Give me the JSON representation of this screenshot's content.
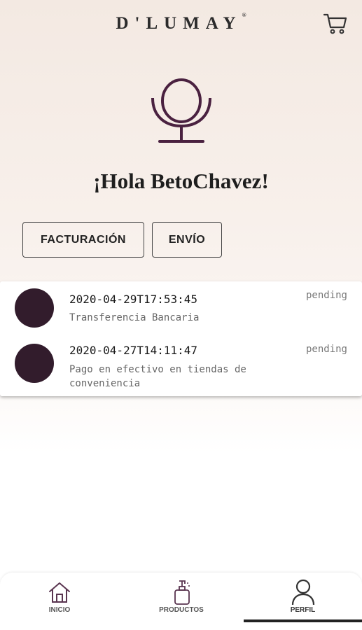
{
  "header": {
    "brand": "D'LUMAY",
    "registered_mark": "®",
    "cart_icon": "cart-icon"
  },
  "profile": {
    "icon": "mirror-icon",
    "greeting": "¡Hola BetoChavez!"
  },
  "actions": {
    "billing_label": "FACTURACIÓN",
    "shipping_label": "ENVÍO"
  },
  "orders": [
    {
      "date": "2020-04-29T17:53:45",
      "method": "Transferencia Bancaria",
      "status": "pending"
    },
    {
      "date": "2020-04-27T14:11:47",
      "method": "Pago en efectivo en tiendas de conveniencia",
      "status": "pending"
    }
  ],
  "nav": {
    "items": [
      {
        "label": "INICIO",
        "icon": "home-icon"
      },
      {
        "label": "PRODUCTOS",
        "icon": "bottle-icon"
      },
      {
        "label": "PERFIL",
        "icon": "user-icon",
        "active": true
      }
    ]
  },
  "colors": {
    "accent": "#4a2140",
    "avatar": "#321c2c",
    "text": "#222222"
  }
}
